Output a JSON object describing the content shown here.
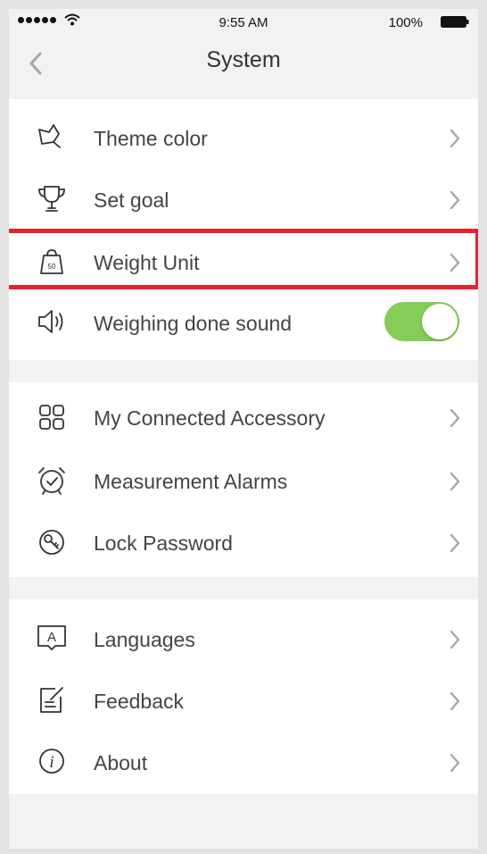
{
  "status_bar": {
    "time": "9:55 AM",
    "battery": "100%"
  },
  "nav": {
    "title": "System"
  },
  "groups": [
    {
      "items": [
        {
          "label": "Theme color",
          "icon": "theme-color-icon"
        },
        {
          "label": "Set goal",
          "icon": "trophy-icon"
        },
        {
          "label": "Weight Unit",
          "icon": "weight-icon",
          "icon_text": "50"
        },
        {
          "label": "Weighing done sound",
          "icon": "speaker-icon",
          "toggle_on": true
        }
      ]
    },
    {
      "items": [
        {
          "label": "My Connected Accessory",
          "icon": "accessory-grid-icon"
        },
        {
          "label": "Measurement Alarms",
          "icon": "alarm-clock-icon"
        },
        {
          "label": "Lock Password",
          "icon": "lock-key-icon"
        }
      ]
    },
    {
      "items": [
        {
          "label": "Languages",
          "icon": "language-icon",
          "icon_text": "A"
        },
        {
          "label": "Feedback",
          "icon": "feedback-icon"
        },
        {
          "label": "About",
          "icon": "info-icon",
          "icon_text": "i"
        }
      ]
    }
  ],
  "colors": {
    "toggle_on": "#86cc59",
    "highlight": "#e8212b",
    "text": "#444444",
    "background": "#f2f2f2"
  }
}
